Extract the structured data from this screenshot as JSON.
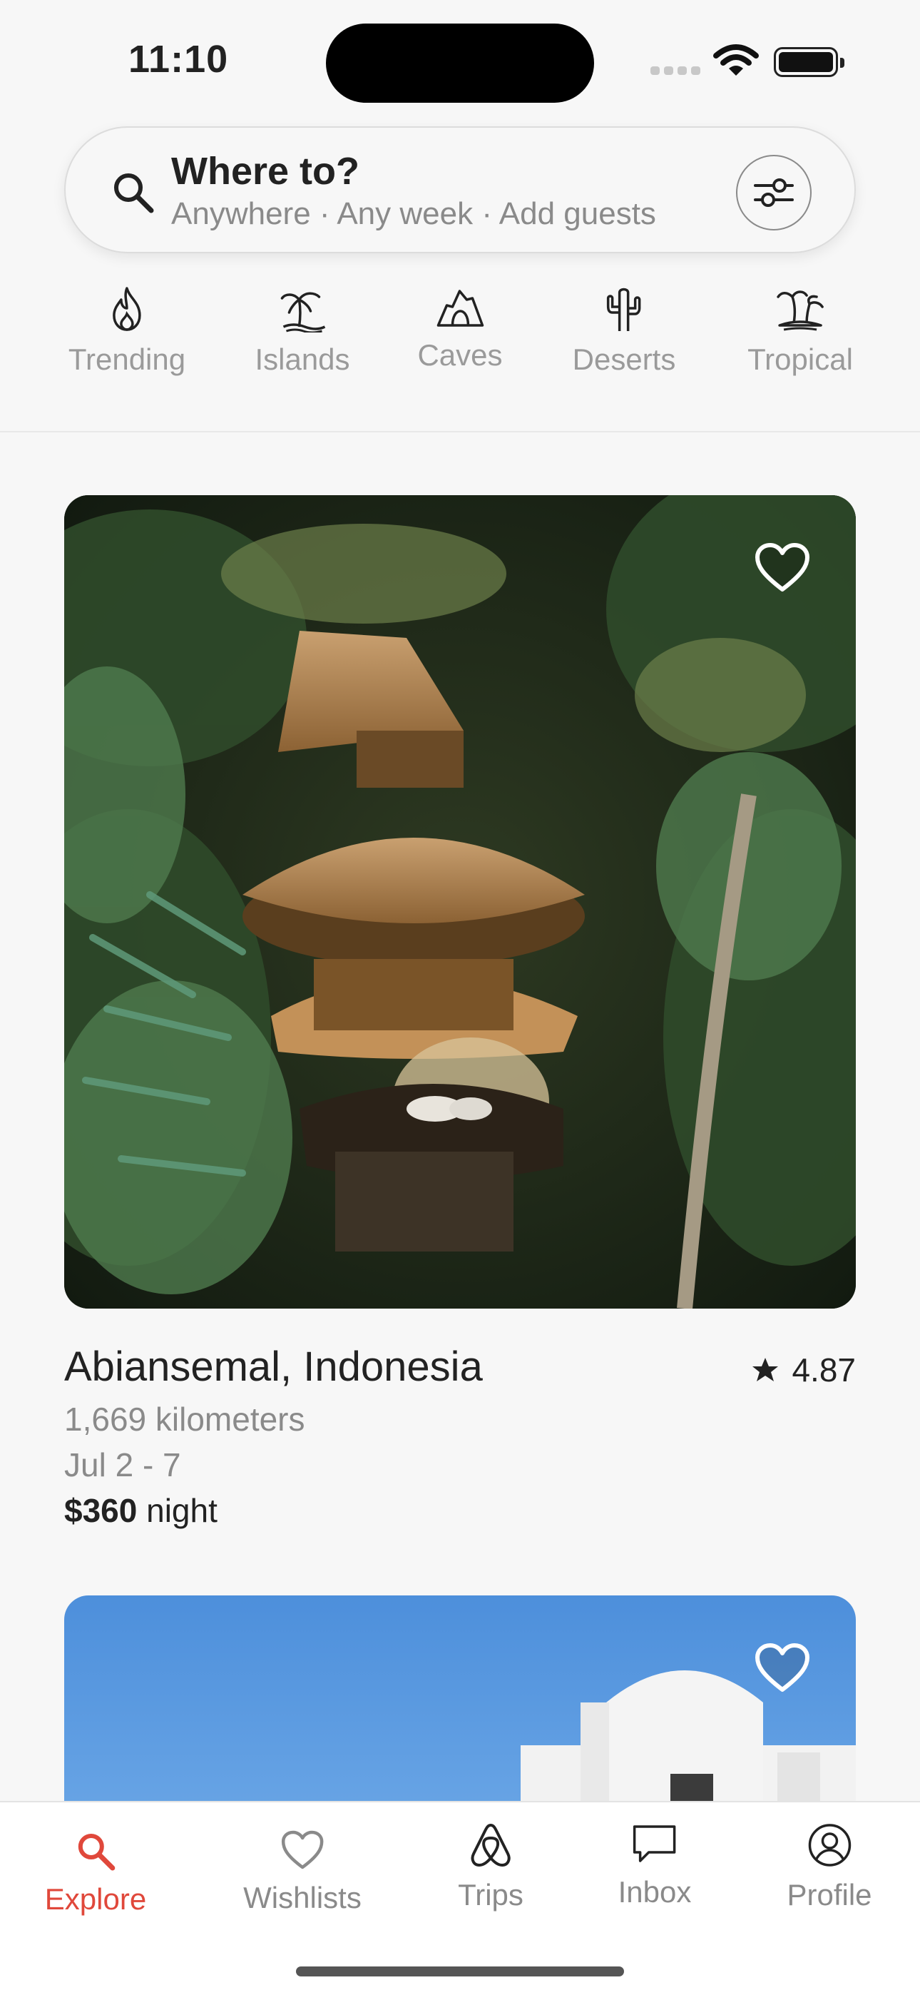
{
  "status_bar": {
    "time": "11:10"
  },
  "search": {
    "title": "Where to?",
    "subtitle": "Anywhere · Any week · Add guests"
  },
  "categories": [
    {
      "label": "Trending",
      "icon": "fire-icon"
    },
    {
      "label": "Islands",
      "icon": "palm-island-icon"
    },
    {
      "label": "Caves",
      "icon": "cave-icon"
    },
    {
      "label": "Deserts",
      "icon": "cactus-icon"
    },
    {
      "label": "Tropical",
      "icon": "tropical-palms-icon"
    }
  ],
  "listing": {
    "title": "Abiansemal, Indonesia",
    "rating": "4.87",
    "distance": "1,669 kilometers",
    "dates": "Jul 2 - 7",
    "price": "$360",
    "price_unit": " night"
  },
  "tabs": [
    {
      "label": "Explore",
      "icon": "search-icon",
      "active": true
    },
    {
      "label": "Wishlists",
      "icon": "heart-icon",
      "active": false
    },
    {
      "label": "Trips",
      "icon": "airbnb-logo-icon",
      "active": false
    },
    {
      "label": "Inbox",
      "icon": "message-icon",
      "active": false
    },
    {
      "label": "Profile",
      "icon": "profile-icon",
      "active": false
    }
  ],
  "colors": {
    "accent": "#e0483b",
    "muted": "#8a8a8a",
    "text": "#222222"
  }
}
